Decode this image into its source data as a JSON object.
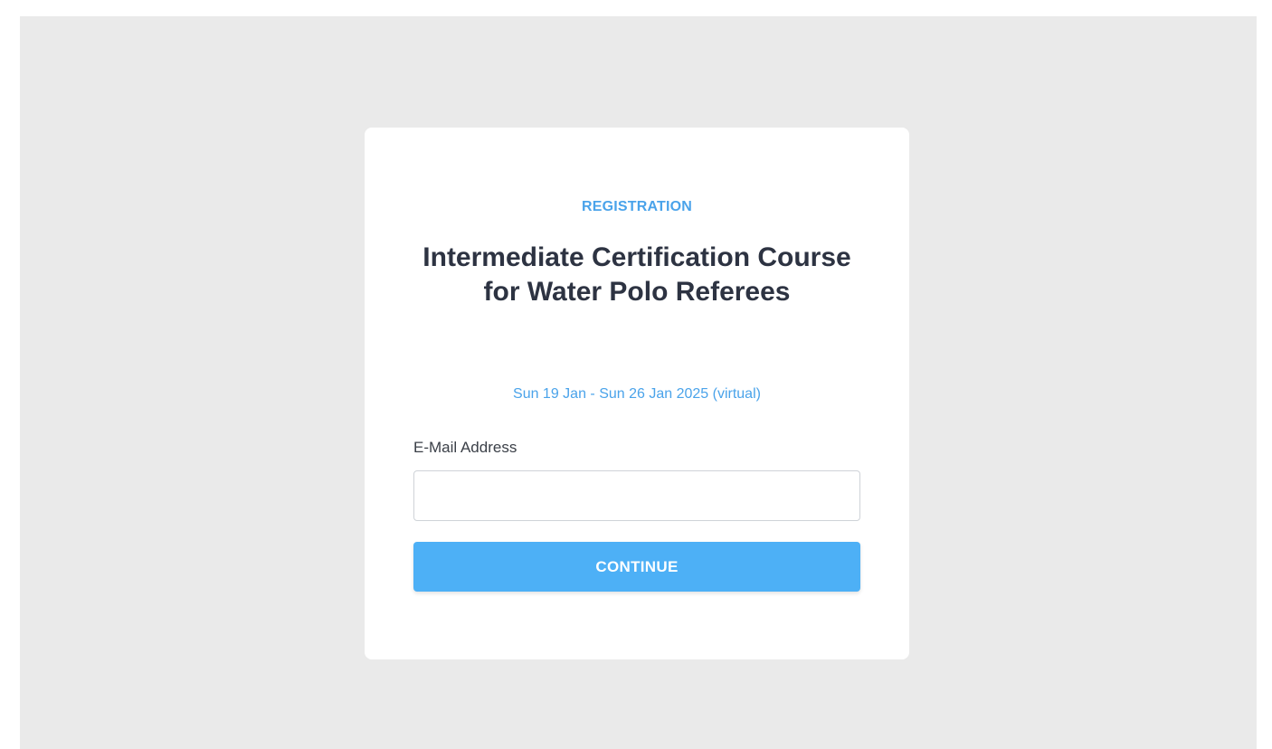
{
  "registration": {
    "eyebrow": "REGISTRATION",
    "title": "Intermediate Certification Course for Water Polo Referees",
    "dates": "Sun 19 Jan - Sun 26 Jan 2025 (virtual)",
    "email_label": "E-Mail Address",
    "email_value": "",
    "continue_label": "CONTINUE"
  },
  "colors": {
    "accent": "#4aa3ea",
    "button": "#4db0f6",
    "page_background": "#eaeaea",
    "card_background": "#ffffff",
    "title_text": "#2d3342"
  }
}
